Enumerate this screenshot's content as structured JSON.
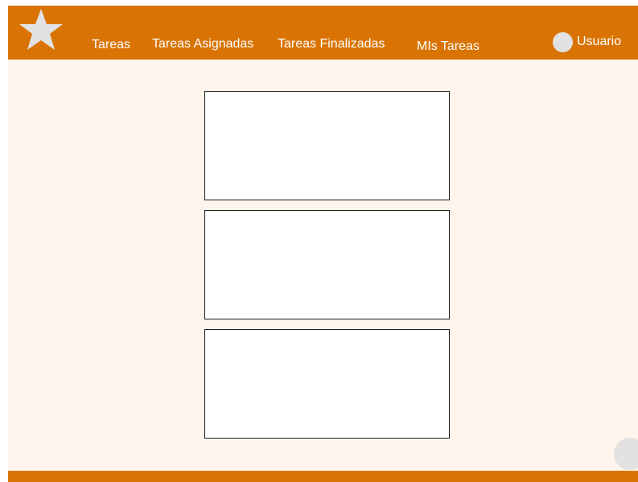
{
  "colors": {
    "brand": "#d97404",
    "background": "#fff5ec",
    "card": "#ffffff",
    "neutral": "#e2e2e2"
  },
  "header": {
    "logo_icon": "star-icon",
    "nav": {
      "tareas": "Tareas",
      "asignadas": "Tareas Asignadas",
      "finalizadas": "Tareas Finalizadas",
      "mis_tareas": "MIs Tareas"
    },
    "user": {
      "avatar_icon": "avatar-circle",
      "label": "Usuario"
    }
  },
  "main": {
    "cards": [
      {
        "content": ""
      },
      {
        "content": ""
      },
      {
        "content": ""
      }
    ]
  },
  "fab": {
    "icon": "circle-button"
  }
}
